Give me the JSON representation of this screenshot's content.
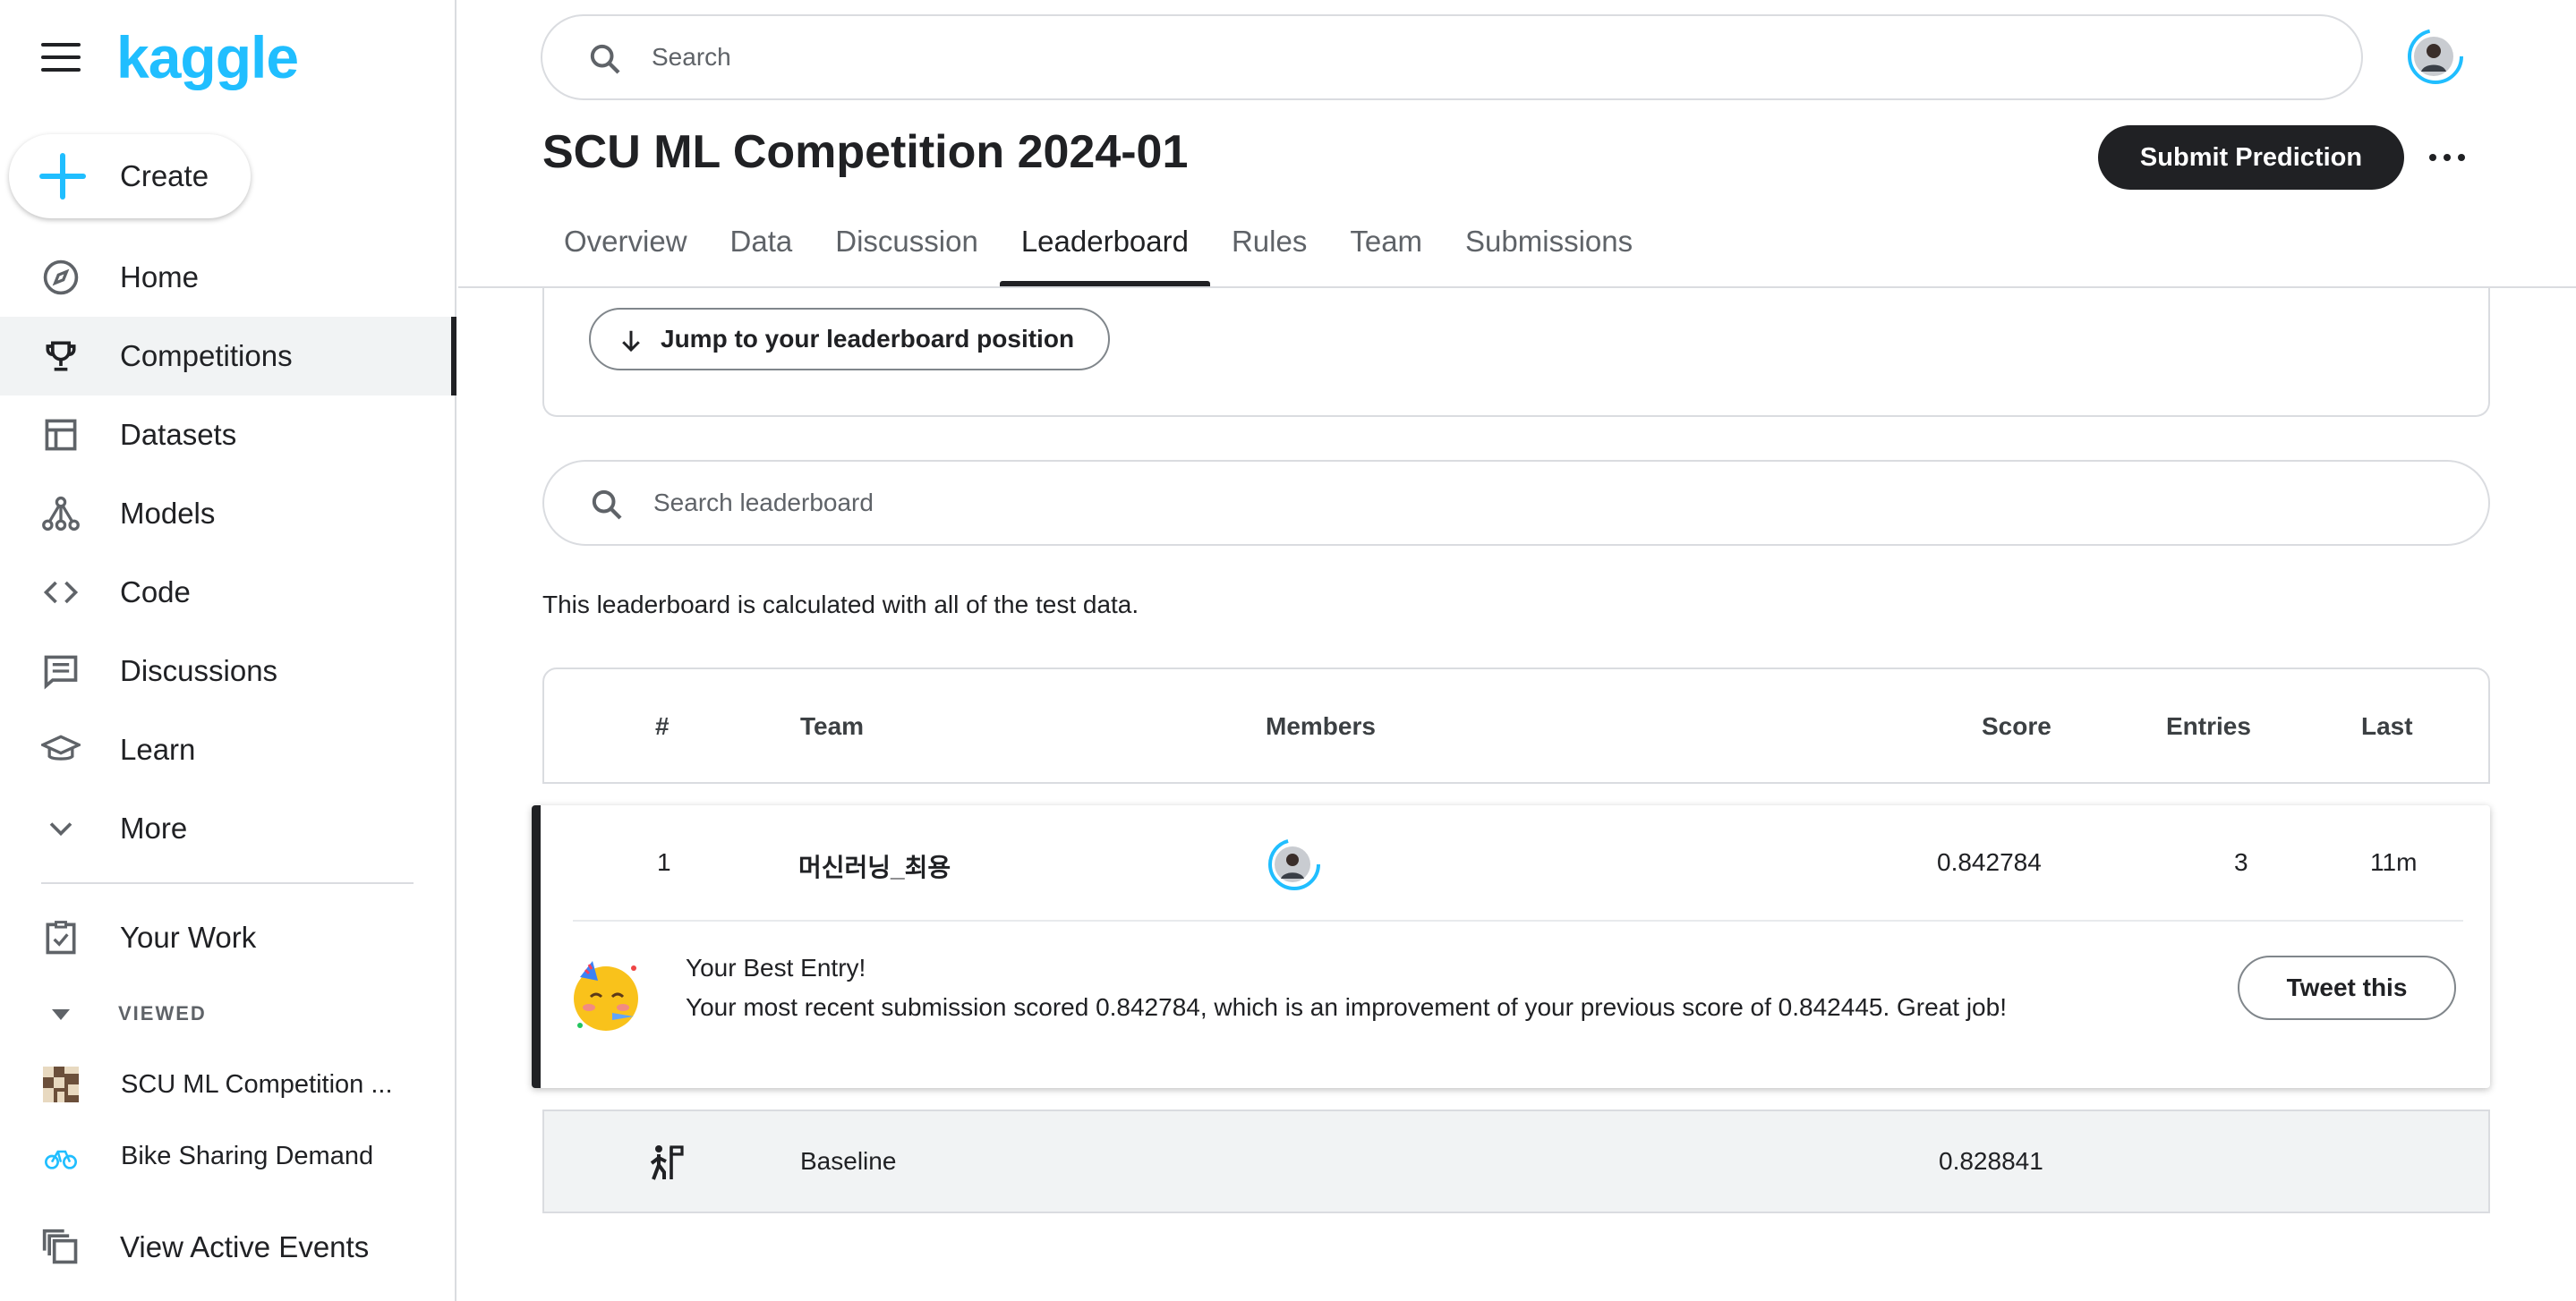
{
  "sidebar": {
    "logo": "kaggle",
    "create_label": "Create",
    "items": [
      {
        "label": "Home",
        "icon": "compass-icon"
      },
      {
        "label": "Competitions",
        "icon": "trophy-icon",
        "active": true
      },
      {
        "label": "Datasets",
        "icon": "table-icon"
      },
      {
        "label": "Models",
        "icon": "models-icon"
      },
      {
        "label": "Code",
        "icon": "code-icon"
      },
      {
        "label": "Discussions",
        "icon": "discussion-icon"
      },
      {
        "label": "Learn",
        "icon": "school-icon"
      },
      {
        "label": "More",
        "icon": "chevron-down-icon"
      }
    ],
    "your_work": "Your Work",
    "viewed_heading": "VIEWED",
    "viewed": [
      {
        "label": "SCU ML Competition ..."
      },
      {
        "label": "Bike Sharing Demand"
      }
    ],
    "active_events": "View Active Events"
  },
  "header": {
    "search_placeholder": "Search"
  },
  "competition": {
    "title": "SCU ML Competition 2024-01",
    "submit_label": "Submit Prediction",
    "tabs": [
      "Overview",
      "Data",
      "Discussion",
      "Leaderboard",
      "Rules",
      "Team",
      "Submissions"
    ],
    "active_tab": "Leaderboard"
  },
  "leaderboard": {
    "jump_label": "Jump to your leaderboard position",
    "search_placeholder": "Search leaderboard",
    "note": "This leaderboard is calculated with all of the test data.",
    "columns": {
      "rank": "#",
      "team": "Team",
      "members": "Members",
      "score": "Score",
      "entries": "Entries",
      "last": "Last"
    },
    "rows": [
      {
        "rank": "1",
        "team": "머신러닝_최용",
        "score": "0.842784",
        "entries": "3",
        "last": "11m"
      }
    ],
    "best_entry": {
      "title": "Your Best Entry!",
      "message": "Your most recent submission scored 0.842784, which is an improvement of your previous score of 0.842445. Great job!",
      "tweet_label": "Tweet this"
    },
    "baseline": {
      "team": "Baseline",
      "score": "0.828841"
    }
  },
  "colors": {
    "brand": "#20beff",
    "dark": "#202124",
    "border": "#dadce0"
  }
}
